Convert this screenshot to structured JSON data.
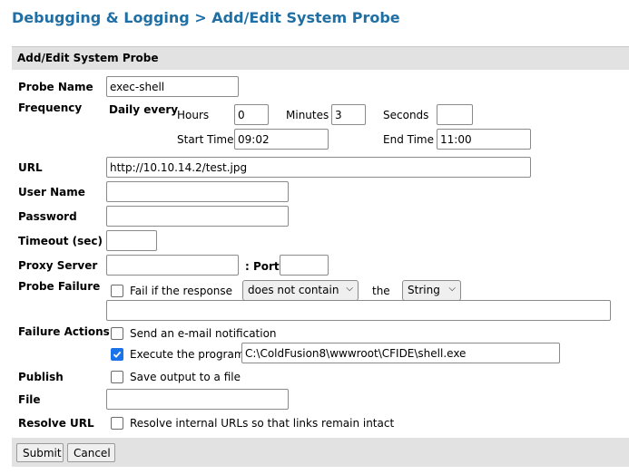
{
  "page": {
    "title": "Debugging & Logging > Add/Edit System Probe"
  },
  "section": {
    "title": "Add/Edit System Probe"
  },
  "form": {
    "probe_name": {
      "label": "Probe Name",
      "value": "exec-shell"
    },
    "frequency": {
      "label": "Frequency",
      "mode": "Daily every",
      "hours_label": "Hours",
      "hours_value": "0",
      "minutes_label": "Minutes",
      "minutes_value": "3",
      "seconds_label": "Seconds",
      "seconds_value": "",
      "start_label": "Start Time",
      "start_value": "09:02",
      "end_label": "End Time",
      "end_value": "11:00"
    },
    "url": {
      "label": "URL",
      "value": "http://10.10.14.2/test.jpg"
    },
    "user_name": {
      "label": "User Name",
      "value": ""
    },
    "password": {
      "label": "Password",
      "value": ""
    },
    "timeout": {
      "label": "Timeout (sec)",
      "value": ""
    },
    "proxy": {
      "label": "Proxy Server",
      "value": "",
      "port_label": ": Port",
      "port_value": ""
    },
    "probe_failure": {
      "label": "Probe Failure",
      "checkbox_label": "Fail if the response",
      "checked": false,
      "condition": "does not contain",
      "the_label": "the",
      "type": "String",
      "string_value": ""
    },
    "failure_actions": {
      "label": "Failure Actions",
      "email_label": "Send an e-mail notification",
      "email_checked": false,
      "execute_label": "Execute the program",
      "execute_checked": true,
      "program_path": "C:\\ColdFusion8\\wwwroot\\CFIDE\\shell.exe"
    },
    "publish": {
      "label": "Publish",
      "checkbox_label": "Save output to a file",
      "checked": false
    },
    "file": {
      "label": "File",
      "value": ""
    },
    "resolve_url": {
      "label": "Resolve URL",
      "checkbox_label": "Resolve internal URLs so that links remain intact",
      "checked": false
    }
  },
  "buttons": {
    "submit": "Submit",
    "cancel": "Cancel"
  },
  "colors": {
    "title": "#1f6fa5",
    "bar": "#e2e2e2",
    "checkbox_checked": "#1a73e8"
  }
}
